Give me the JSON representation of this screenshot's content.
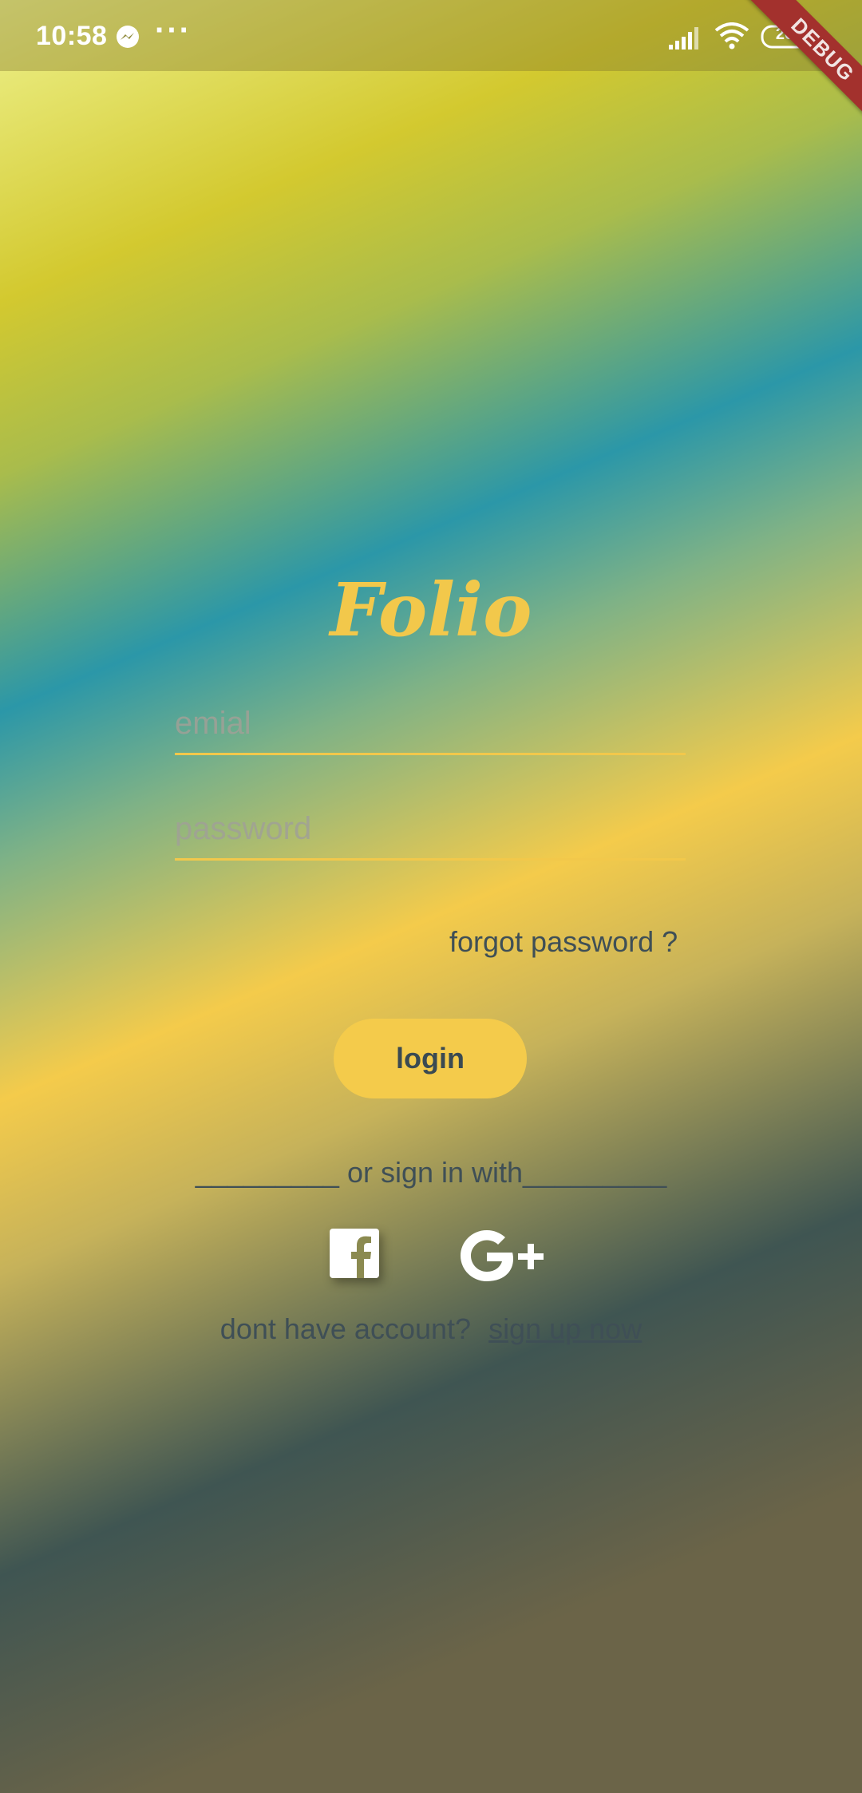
{
  "status_bar": {
    "time": "10:58",
    "more": "···",
    "battery": "26"
  },
  "debug_banner": "DEBUG",
  "app": {
    "logo": "Folio"
  },
  "form": {
    "email_placeholder": "emial",
    "password_placeholder": "password",
    "forgot_password": "forgot password ?",
    "login_label": "login"
  },
  "social": {
    "divider_text": "_________ or sign in with_________"
  },
  "signup": {
    "prompt": "dont have account?",
    "link": "sign up now"
  },
  "colors": {
    "accent": "#f2c84b",
    "text": "#3f4f56",
    "debug": "#a3312d"
  }
}
